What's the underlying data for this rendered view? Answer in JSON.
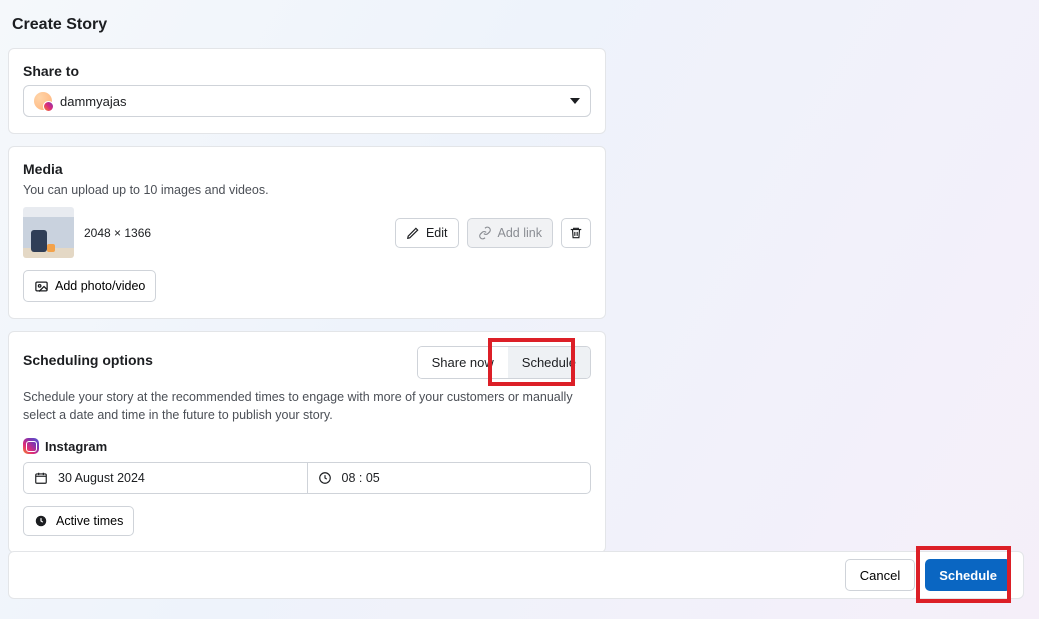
{
  "page_title": "Create Story",
  "share": {
    "section_title": "Share to",
    "account_name": "dammyajas"
  },
  "media": {
    "section_title": "Media",
    "hint": "You can upload up to 10 images and videos.",
    "dimensions": "2048 × 1366",
    "edit_label": "Edit",
    "add_link_label": "Add link",
    "add_photo_label": "Add photo/video"
  },
  "scheduling": {
    "section_title": "Scheduling options",
    "share_now_label": "Share now",
    "schedule_label": "Schedule",
    "description": "Schedule your story at the recommended times to engage with more of your customers or manually select a date and time in the future to publish your story.",
    "platform_label": "Instagram",
    "date_value": "30 August 2024",
    "time_value": "08 : 05",
    "active_times_label": "Active times"
  },
  "footer": {
    "cancel_label": "Cancel",
    "schedule_label": "Schedule"
  }
}
